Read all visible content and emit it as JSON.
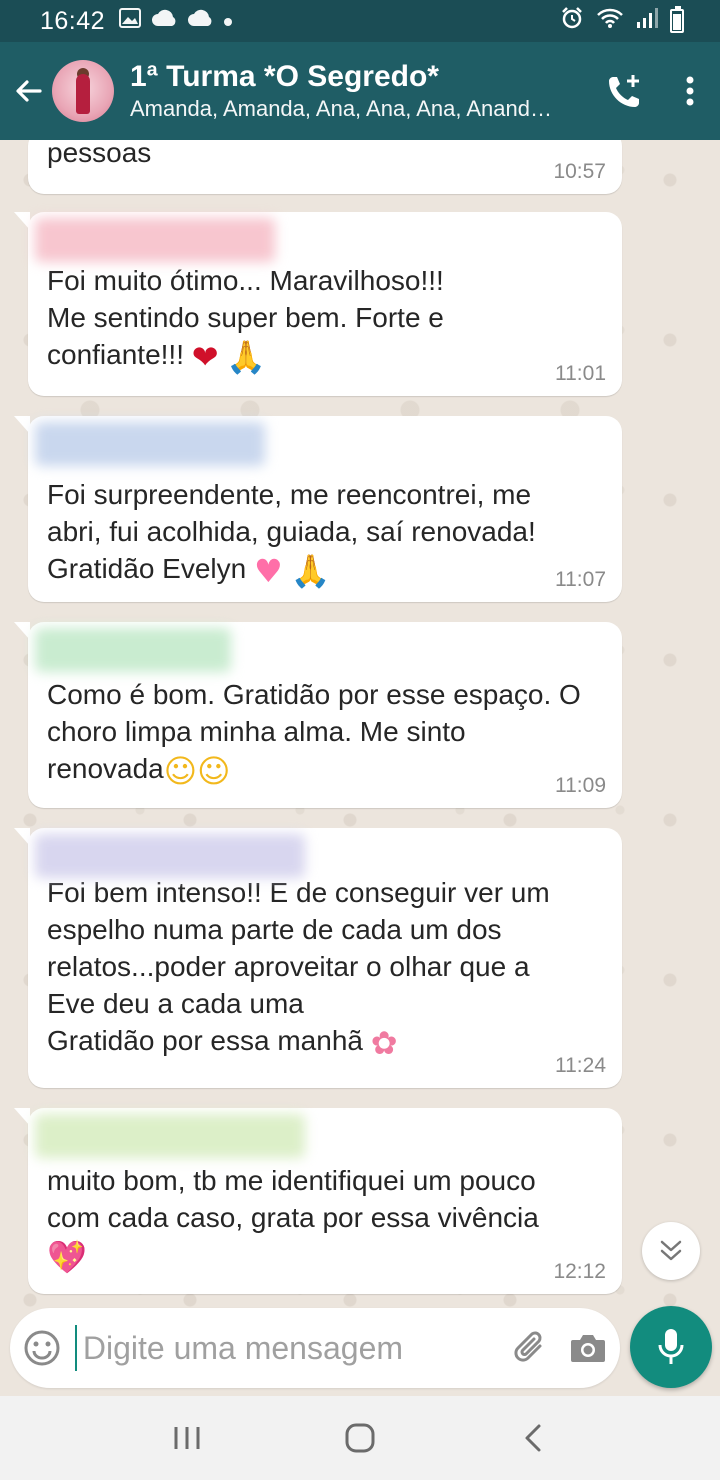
{
  "status_bar": {
    "time": "16:42",
    "left_icons": [
      "image-icon",
      "cloud-icon",
      "cloud-icon",
      "dot-icon"
    ],
    "right_icons": [
      "alarm-icon",
      "wifi-icon",
      "signal-icon",
      "battery-icon"
    ]
  },
  "header": {
    "title": "1ª Turma *O Segredo*",
    "subtitle": "Amanda, Amanda, Ana, Ana, Ana, Anand…",
    "accent_color": "#1f5d65"
  },
  "messages": [
    {
      "text": "pessoas",
      "time": "10:57",
      "emojis": []
    },
    {
      "text": "Foi muito ótimo... Maravilhoso!!!\nMe sentindo super bem. Forte e\nconfiante!!! ",
      "time": "11:01",
      "emojis": [
        "red-heart",
        "folded-hands"
      ]
    },
    {
      "text": "Foi surpreendente, me reencontrei, me\nabri, fui acolhida, guiada, saí renovada!\nGratidão Evelyn ",
      "time": "11:07",
      "emojis": [
        "growing-heart",
        "folded-hands"
      ]
    },
    {
      "text": "Como é bom. Gratidão por esse espaço. O\nchoro limpa minha alma. Me sinto\nrenovada",
      "time": "11:09",
      "emojis": [
        "smiling-face",
        "smiling-face"
      ]
    },
    {
      "text": "Foi bem intenso!! E de conseguir ver um\nespelho numa parte de cada um dos\nrelatos...poder aproveitar o olhar que a\nEve deu a cada uma\nGratidão por essa manhã ",
      "time": "11:24",
      "emojis": [
        "cherry-blossom"
      ]
    },
    {
      "text": "muito bom, tb me identifiquei um pouco\ncom cada caso, grata por essa vivência\n",
      "time": "12:12",
      "emojis": [
        "sparkling-heart"
      ]
    }
  ],
  "input": {
    "placeholder": "Digite uma mensagem"
  }
}
